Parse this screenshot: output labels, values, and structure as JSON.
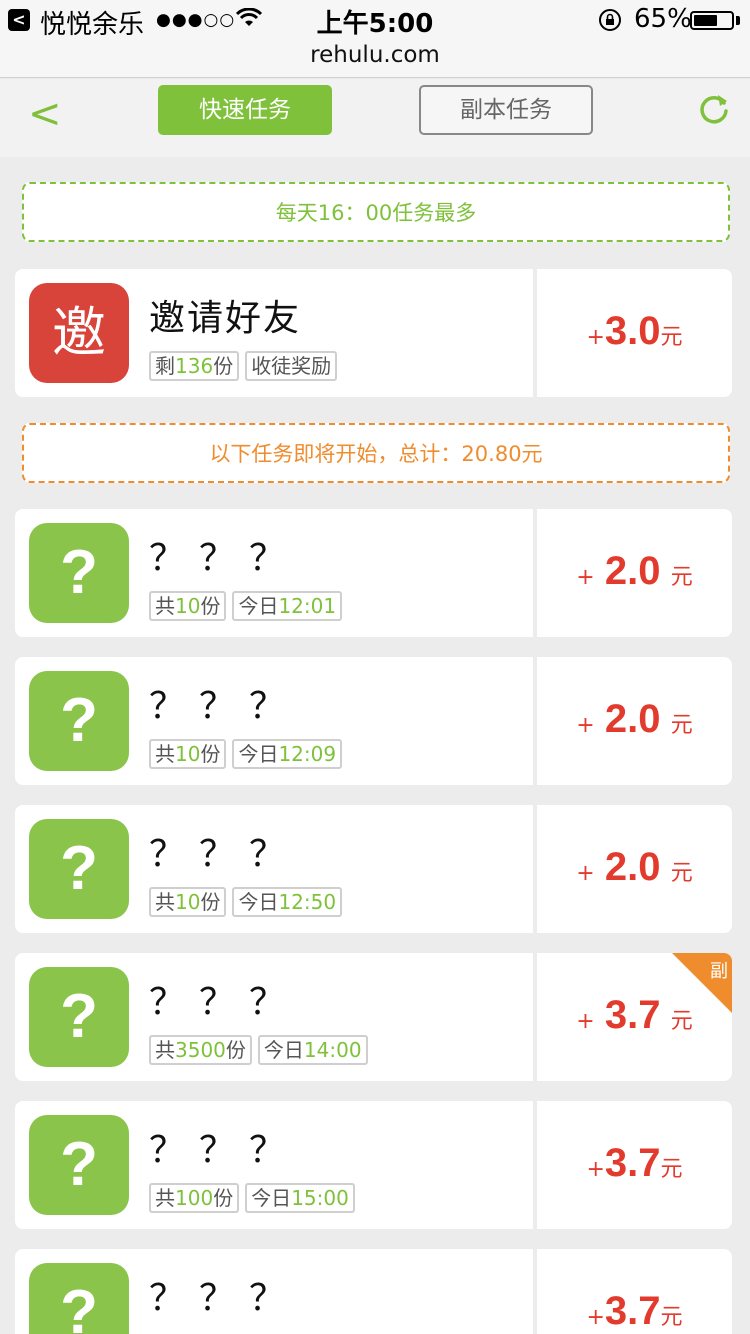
{
  "status": {
    "back_arrow": "<",
    "app_name": "悦悦余乐",
    "signal": "●●●○○",
    "time": "上午5:00",
    "battery_pct": "65%",
    "battery_level": 0.65
  },
  "url": "rehulu.com",
  "nav": {
    "back": "<",
    "tab_fast": "快速任务",
    "tab_copy": "副本任务"
  },
  "banner_top": "每天16：00任务最多",
  "invite": {
    "icon_char": "邀",
    "title": "邀请好友",
    "tag1_prefix": "剩",
    "tag1_num": "136",
    "tag1_suffix": "份",
    "tag2": "收徒奖励",
    "plus": "+",
    "value": "3.0",
    "unit": "元"
  },
  "banner_upcoming": "以下任务即将开始，总计：20.80元",
  "tasks": [
    {
      "icon_char": "?",
      "title": "？？？",
      "count_prefix": "共",
      "count": "10",
      "count_suffix": "份",
      "time_prefix": "今日",
      "time": "12:01",
      "plus": "+",
      "value": "2.0",
      "unit": "元"
    },
    {
      "icon_char": "?",
      "title": "？？？",
      "count_prefix": "共",
      "count": "10",
      "count_suffix": "份",
      "time_prefix": "今日",
      "time": "12:09",
      "plus": "+",
      "value": "2.0",
      "unit": "元"
    },
    {
      "icon_char": "?",
      "title": "？？？",
      "count_prefix": "共",
      "count": "10",
      "count_suffix": "份",
      "time_prefix": "今日",
      "time": "12:50",
      "plus": "+",
      "value": "2.0",
      "unit": "元"
    },
    {
      "icon_char": "?",
      "title": "？？？",
      "count_prefix": "共",
      "count": "3500",
      "count_suffix": "份",
      "time_prefix": "今日",
      "time": "14:00",
      "plus": "+",
      "value": "3.7",
      "unit": "元",
      "corner": "副"
    },
    {
      "icon_char": "?",
      "title": "？？？",
      "count_prefix": "共",
      "count": "100",
      "count_suffix": "份",
      "time_prefix": "今日",
      "time": "15:00",
      "plus": "+",
      "value": "3.7",
      "unit": "元"
    },
    {
      "icon_char": "?",
      "title": "？？？",
      "plus": "+",
      "value": "3.7",
      "unit": "元"
    }
  ],
  "colors": {
    "accent_green": "#7fc13b",
    "icon_green": "#8bc44a",
    "invite_red": "#d9443a",
    "reward_red": "#e23b2d",
    "banner_orange": "#ef8c2e"
  }
}
